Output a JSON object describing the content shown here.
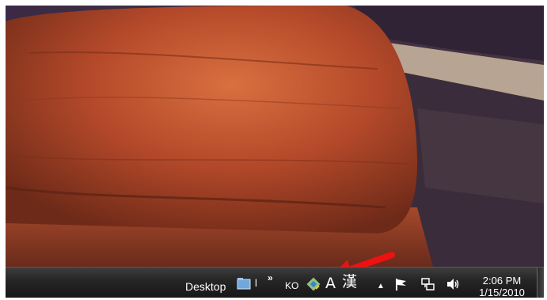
{
  "taskbar": {
    "desktop_label": "Desktop",
    "toolbar_text": "l",
    "overflow_chevron": "»",
    "language": "KO",
    "ime_mode": "A",
    "ime_hanja": "漢",
    "tray_expand": "▲",
    "clock": {
      "time": "2:06 PM",
      "date": "1/15/2010"
    }
  },
  "icons": [
    "folder-icon",
    "ime-pad-icon",
    "flag-icon",
    "network-icon",
    "volume-icon"
  ],
  "colors": {
    "taskbar": "#1e1e1e",
    "annotation_arrow": "#ee1111",
    "rock": "#c0502a"
  }
}
